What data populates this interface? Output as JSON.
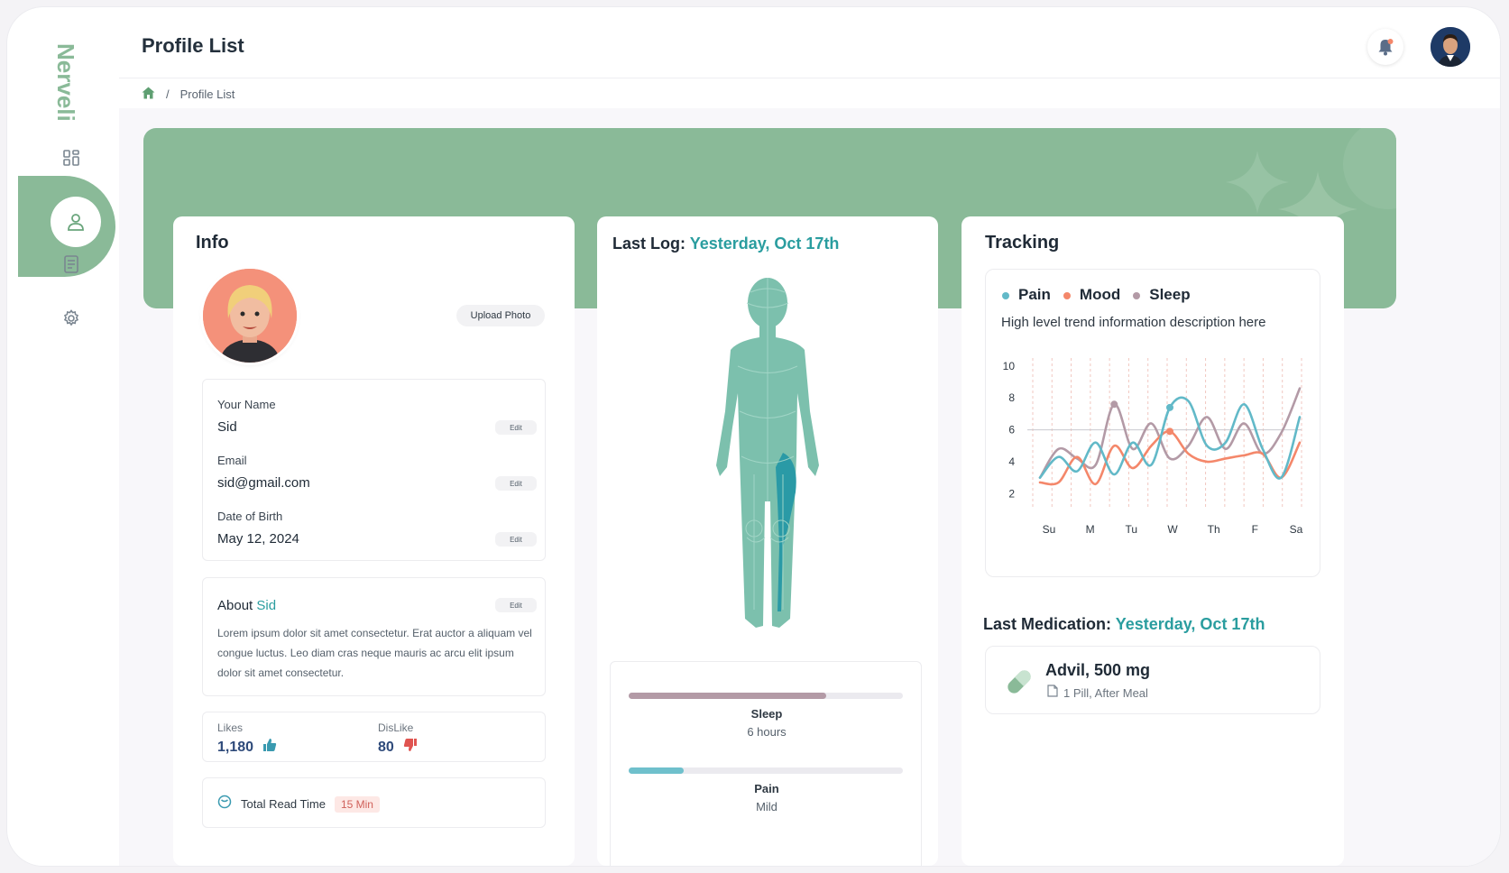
{
  "app": {
    "logo_text": "Nerveli"
  },
  "header": {
    "title": "Profile List",
    "breadcrumb_current": "Profile List",
    "breadcrumb_sep": "/"
  },
  "sidebar": {
    "items": [
      {
        "name": "dashboard",
        "icon": "grid-icon"
      },
      {
        "name": "profile",
        "icon": "user-icon",
        "active": true
      },
      {
        "name": "reports",
        "icon": "document-icon"
      },
      {
        "name": "settings",
        "icon": "gear-icon"
      }
    ]
  },
  "colors": {
    "accent": "#8aba98",
    "teal": "#2a9d9f",
    "pain": "#62b9c8",
    "mood": "#f4876a",
    "sleep": "#b39aa6"
  },
  "info": {
    "title": "Info",
    "upload_label": "Upload Photo",
    "fields": [
      {
        "label": "Your Name",
        "value": "Sid",
        "edit": "Edit"
      },
      {
        "label": "Email",
        "value": "sid@gmail.com",
        "edit": "Edit"
      },
      {
        "label": "Date of Birth",
        "value": "May 12, 2024",
        "edit": "Edit"
      }
    ],
    "about_prefix": "About",
    "about_name": "Sid",
    "about_edit": "Edit",
    "about_text": "Lorem ipsum dolor sit amet consectetur. Erat auctor a aliquam vel congue luctus. Leo diam cras neque mauris ac arcu elit ipsum dolor sit amet consectetur.",
    "likes_label": "Likes",
    "likes_value": "1,180",
    "dislike_label": "DisLike",
    "dislike_value": "80",
    "read_label": "Total Read Time",
    "read_value": "15 Min"
  },
  "last_log": {
    "prefix": "Last Log:",
    "when": "Yesterday, Oct 17th",
    "metrics": [
      {
        "name": "Sleep",
        "value": "6 hours",
        "fraction": 0.72,
        "color": "#b39aa6"
      },
      {
        "name": "Pain",
        "value": "Mild",
        "fraction": 0.2,
        "color": "#6fc0cc"
      }
    ]
  },
  "tracking": {
    "title": "Tracking",
    "description": "High level trend information description here",
    "legend": [
      {
        "name": "Pain",
        "color": "#62b9c8"
      },
      {
        "name": "Mood",
        "color": "#f4876a"
      },
      {
        "name": "Sleep",
        "color": "#b39aa6"
      }
    ]
  },
  "chart_data": {
    "type": "line",
    "categories": [
      "Su",
      "M",
      "Tu",
      "W",
      "Th",
      "F",
      "Sa"
    ],
    "y_ticks": [
      2,
      4,
      6,
      8,
      10
    ],
    "ylim": [
      1,
      10.5
    ],
    "reference_line": 6,
    "grid": "vertical dashed",
    "series": [
      {
        "name": "Pain",
        "color": "#62b9c8",
        "values": [
          3.0,
          4.3,
          3.4,
          5.2,
          3.2,
          5.2,
          3.8,
          7.4,
          7.8,
          5.0,
          5.2,
          7.6,
          4.8,
          3.0,
          6.8
        ]
      },
      {
        "name": "Mood",
        "color": "#f4876a",
        "values": [
          2.7,
          2.7,
          4.3,
          2.6,
          5.0,
          3.6,
          5.0,
          5.9,
          4.5,
          4.0,
          4.2,
          4.4,
          4.5,
          3.0,
          5.2
        ]
      },
      {
        "name": "Sleep",
        "color": "#b39aa6",
        "values": [
          3.0,
          4.8,
          4.2,
          3.8,
          7.6,
          4.8,
          6.4,
          4.2,
          5.0,
          6.8,
          4.8,
          6.4,
          4.5,
          5.8,
          8.6
        ]
      }
    ]
  },
  "medication": {
    "prefix": "Last Medication:",
    "when": "Yesterday, Oct 17th",
    "name": "Advil, 500 mg",
    "detail": "1 Pill, After Meal"
  }
}
